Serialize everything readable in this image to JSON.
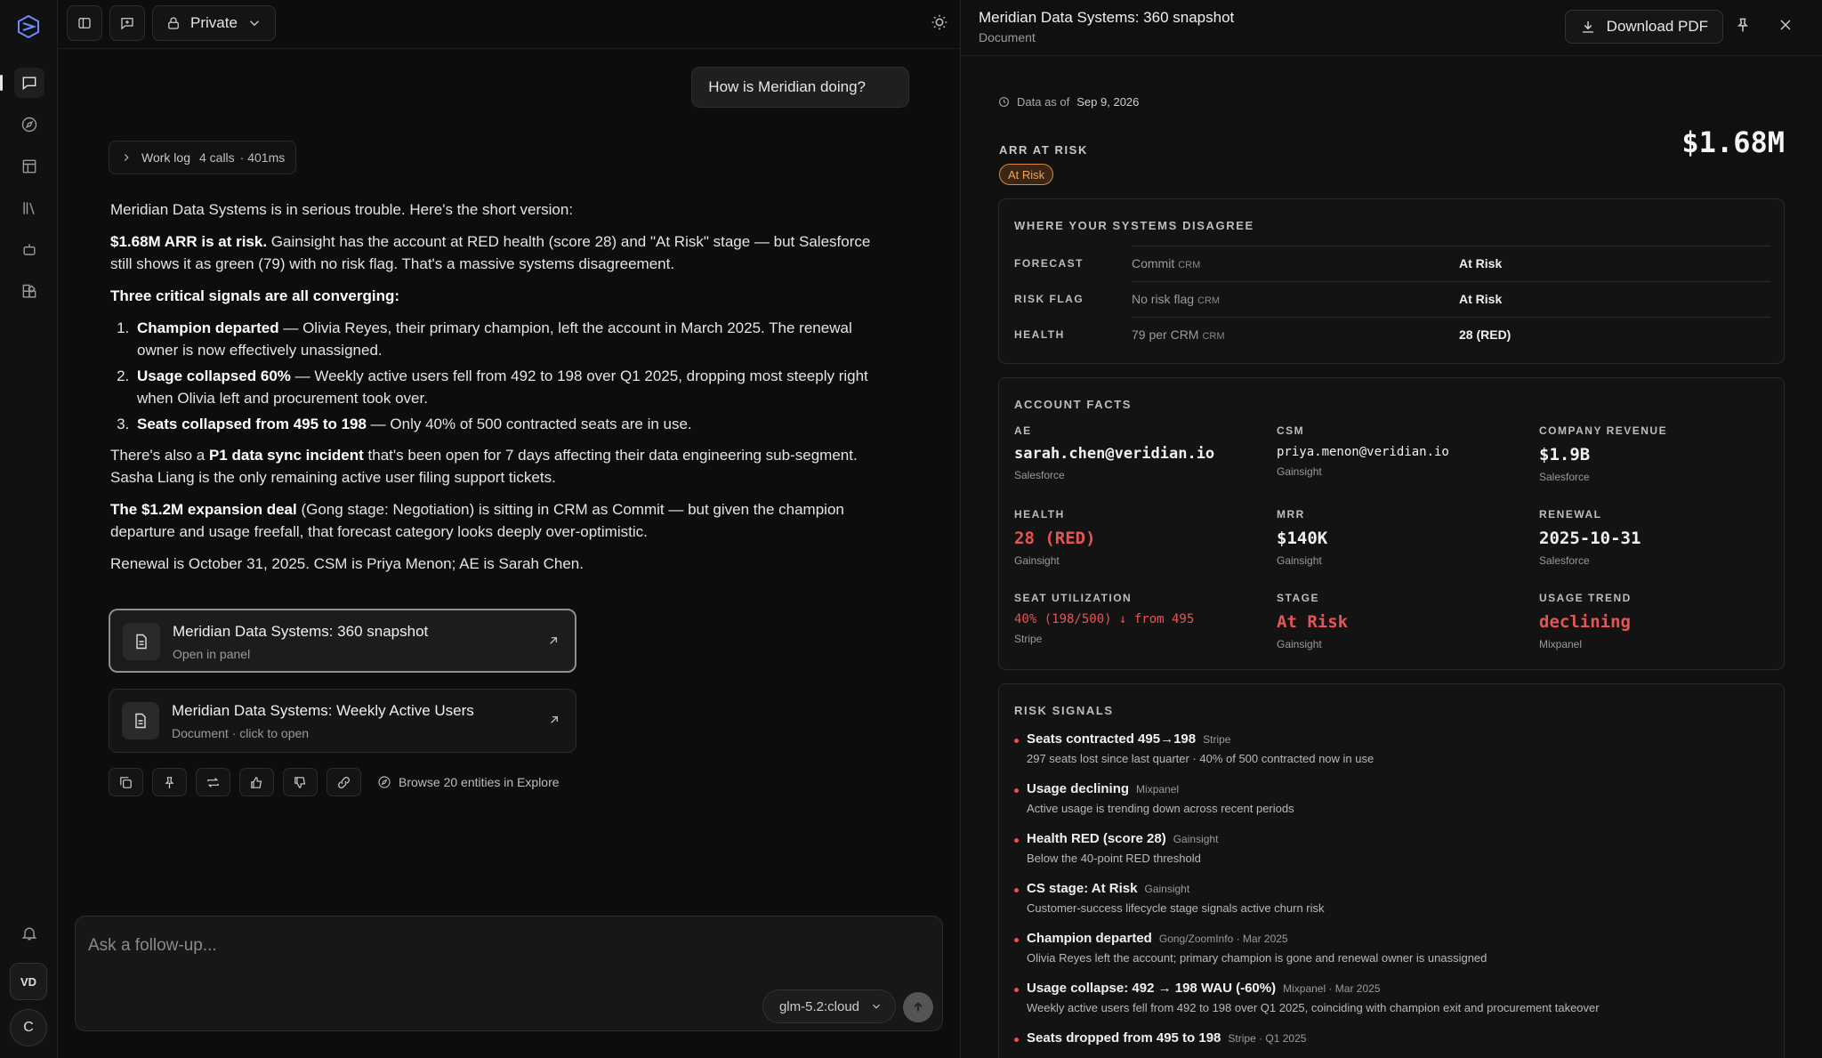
{
  "topbar": {
    "private_label": "Private"
  },
  "chat": {
    "user_message": "How is Meridian doing?",
    "worklog": {
      "label": "Work log",
      "calls": "4 calls",
      "duration": "· 401ms"
    },
    "answer": {
      "intro": "Meridian Data Systems is in serious trouble. Here's the short version:",
      "p1_bold": "$1.68M ARR is at risk.",
      "p1_rest": " Gainsight has the account at RED health (score 28) and \"At Risk\" stage — but Salesforce still shows it as green (79) with no risk flag. That's a massive systems disagreement.",
      "signals_heading": "Three critical signals are all converging:",
      "items": [
        {
          "bold": "Champion departed",
          "rest": " — Olivia Reyes, their primary champion, left the account in March 2025. The renewal owner is now effectively unassigned."
        },
        {
          "bold": "Usage collapsed 60%",
          "rest": " — Weekly active users fell from 492 to 198 over Q1 2025, dropping most steeply right when Olivia left and procurement took over."
        },
        {
          "bold": "Seats collapsed from 495 to 198",
          "rest": " — Only 40% of 500 contracted seats are in use."
        }
      ],
      "p2_a": "There's also a ",
      "p2_bold": "P1 data sync incident",
      "p2_b": " that's been open for 7 days affecting their data engineering sub-segment. Sasha Liang is the only remaining active user filing support tickets.",
      "p3_bold": "The $1.2M expansion deal",
      "p3_rest": " (Gong stage: Negotiation) is sitting in CRM as Commit — but given the champion departure and usage freefall, that forecast category looks deeply over-optimistic.",
      "p4": "Renewal is October 31, 2025. CSM is Priya Menon; AE is Sarah Chen."
    },
    "cards": [
      {
        "title": "Meridian Data Systems: 360 snapshot",
        "subtitle": "Open in panel"
      },
      {
        "title": "Meridian Data Systems: Weekly Active Users",
        "subtitle": "Document · click to open"
      }
    ],
    "explore_label": "Browse 20 entities in Explore",
    "composer": {
      "placeholder": "Ask a follow-up...",
      "model": "glm-5.2:cloud"
    }
  },
  "rail": {
    "user_initials": "VD",
    "account_initial": "C"
  },
  "panel": {
    "title": "Meridian Data Systems: 360 snapshot",
    "subtitle": "Document",
    "download_label": "Download PDF",
    "as_of_label": "Data as of",
    "as_of_date": "Sep 9, 2026",
    "arr_label": "ARR AT RISK",
    "arr_badge": "At Risk",
    "arr_value": "$1.68M",
    "disagree": {
      "heading": "WHERE YOUR SYSTEMS DISAGREE",
      "rows": [
        {
          "key": "FORECAST",
          "crm_value": "Commit",
          "crm_src": "CRM",
          "truth": "At Risk"
        },
        {
          "key": "RISK FLAG",
          "crm_value": "No risk flag",
          "crm_src": "CRM",
          "truth": "At Risk"
        },
        {
          "key": "HEALTH",
          "crm_value": "79 per CRM",
          "crm_src": "CRM",
          "truth": "28 (RED)"
        }
      ]
    },
    "facts": {
      "heading": "ACCOUNT FACTS",
      "items": [
        {
          "key": "AE",
          "value": "sarah.chen@veridian.io",
          "source": "Salesforce"
        },
        {
          "key": "CSM",
          "value": "priya.menon@veridian.io",
          "source": "Gainsight"
        },
        {
          "key": "COMPANY REVENUE",
          "value": "$1.9B",
          "source": "Salesforce"
        },
        {
          "key": "HEALTH",
          "value": "28 (RED)",
          "source": "Gainsight"
        },
        {
          "key": "MRR",
          "value": "$140K",
          "source": "Gainsight"
        },
        {
          "key": "RENEWAL",
          "value": "2025-10-31",
          "source": "Salesforce"
        },
        {
          "key": "SEAT UTILIZATION",
          "value": "40% (198/500) ↓ from 495",
          "source": "Stripe"
        },
        {
          "key": "STAGE",
          "value": "At Risk",
          "source": "Gainsight"
        },
        {
          "key": "USAGE TREND",
          "value": "declining",
          "source": "Mixpanel"
        }
      ]
    },
    "signals": {
      "heading": "RISK SIGNALS",
      "items": [
        {
          "title": "Seats contracted 495→198",
          "source": "Stripe",
          "desc": "297 seats lost since last quarter · 40% of 500 contracted now in use"
        },
        {
          "title": "Usage declining",
          "source": "Mixpanel",
          "desc": "Active usage is trending down across recent periods"
        },
        {
          "title": "Health RED (score 28)",
          "source": "Gainsight",
          "desc": "Below the 40-point RED threshold"
        },
        {
          "title": "CS stage: At Risk",
          "source": "Gainsight",
          "desc": "Customer-success lifecycle stage signals active churn risk"
        },
        {
          "title": "Champion departed",
          "source": "Gong/ZoomInfo · Mar 2025",
          "desc": "Olivia Reyes left the account; primary champion is gone and renewal owner is unassigned"
        },
        {
          "title": "Usage collapse: 492 → 198 WAU (-60%)",
          "source": "Mixpanel · Mar 2025",
          "desc": "Weekly active users fell from 492 to 198 over Q1 2025, coinciding with champion exit and procurement takeover"
        },
        {
          "title": "Seats dropped from 495 to 198",
          "source": "Stripe · Q1 2025",
          "desc": ""
        }
      ]
    }
  }
}
